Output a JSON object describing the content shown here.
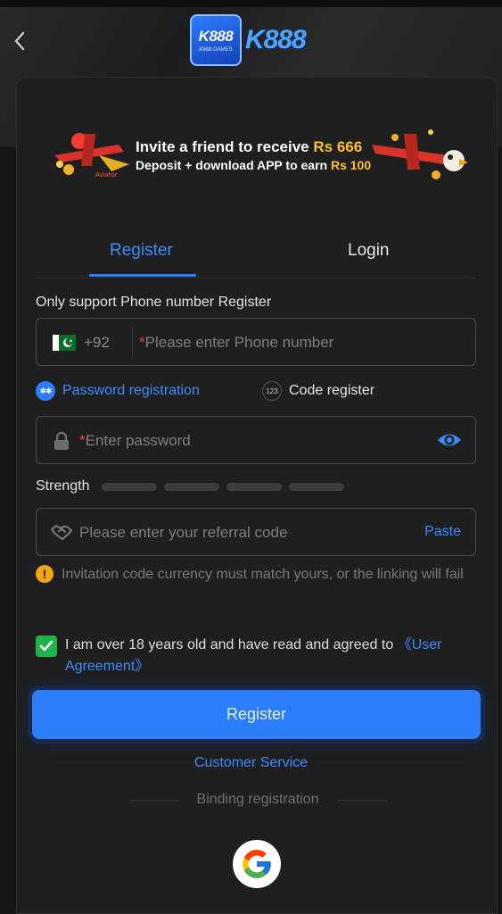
{
  "logo": {
    "badge_text": "K888",
    "badge_sub": "K888.GAMES",
    "brand": "K888"
  },
  "banner": {
    "line1_prefix": "Invite a friend to receive",
    "line1_amount": "Rs 666",
    "line2_prefix": "Deposit + download APP to earn",
    "line2_amount": "Rs 100"
  },
  "tabs": {
    "register": "Register",
    "login": "Login",
    "active": "register"
  },
  "form": {
    "phone_hint": "Only support Phone number Register",
    "country_code": "+92",
    "phone_placeholder": "Please enter Phone number",
    "modes": {
      "password": "Password registration",
      "code": "Code register",
      "code_icon": "123",
      "active": "password"
    },
    "password_placeholder": "Enter password",
    "strength_label": "Strength",
    "strength_level": 0,
    "strength_segments": 4,
    "referral_placeholder": "Please enter your referral code",
    "paste_label": "Paste",
    "warning": "Invitation code currency must match yours, or the linking will fail",
    "agreement_text": "I am over 18 years old and have read and agreed to ",
    "agreement_link": "《User Agreement》",
    "agreement_checked": true,
    "submit_label": "Register"
  },
  "footer": {
    "customer_service": "Customer Service",
    "binding_label": "Binding registration"
  },
  "icons": {
    "back": "chevron-left-icon",
    "lock": "lock-icon",
    "eye": "eye-icon",
    "handshake": "handshake-icon",
    "warning": "warning-icon",
    "google": "google-icon"
  },
  "colors": {
    "accent": "#2f7dff",
    "background": "#1f1f20",
    "gold": "#ffbf2e",
    "check": "#1fb34a",
    "warning": "#f3a615",
    "required": "#e04545"
  }
}
